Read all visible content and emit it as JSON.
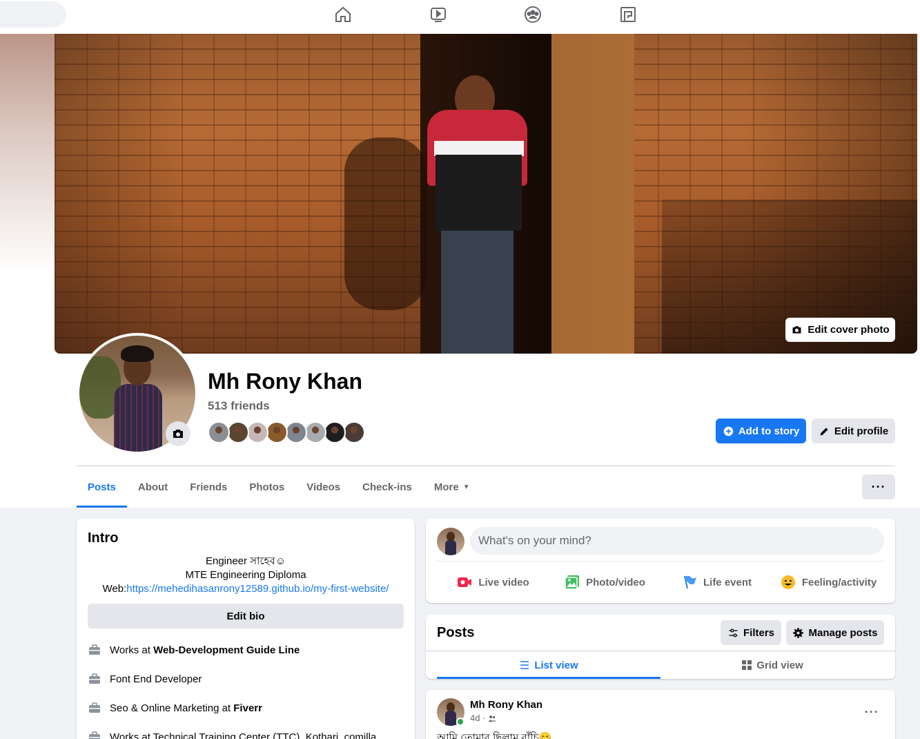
{
  "nav": {
    "icons": [
      "home-icon",
      "watch-icon",
      "groups-icon",
      "gaming-icon"
    ]
  },
  "cover": {
    "edit_label": "Edit cover photo"
  },
  "profile": {
    "name": "Mh Rony Khan",
    "friends_count": "513 friends",
    "friend_avatar_colors": [
      "#8b8f95",
      "#5a4630",
      "#c7b6b9",
      "#8a5a2a",
      "#7d8691",
      "#a9acae",
      "#1e1e1e",
      "#4a3b36"
    ]
  },
  "actions": {
    "add_story": "Add to story",
    "edit_profile": "Edit profile",
    "more_options": "···"
  },
  "tabs": [
    {
      "label": "Posts",
      "active": true
    },
    {
      "label": "About"
    },
    {
      "label": "Friends"
    },
    {
      "label": "Photos"
    },
    {
      "label": "Videos"
    },
    {
      "label": "Check-ins"
    },
    {
      "label": "More"
    }
  ],
  "intro": {
    "title": "Intro",
    "bio_line1": "Engineer সাহেব☺",
    "bio_line2": "MTE Engineering Diploma",
    "bio_web_prefix": "Web:",
    "bio_web_link": "https://mehedihasanrony12589.github.io/my-first-website/",
    "edit_bio": "Edit bio",
    "items": [
      {
        "prefix": "Works at ",
        "bold": "Web-Development Guide Line"
      },
      {
        "prefix": "Font End Developer",
        "bold": ""
      },
      {
        "prefix": "Seo & Online Marketing at ",
        "bold": "Fiverr"
      },
      {
        "prefix": "Works at Technical Training Center (TTC), Kothari, comilla",
        "bold": ""
      }
    ]
  },
  "composer": {
    "placeholder": "What's on your mind?",
    "live_video": "Live video",
    "photo_video": "Photo/video",
    "life_event": "Life event",
    "feeling": "Feeling/activity"
  },
  "posts_section": {
    "title": "Posts",
    "filters": "Filters",
    "manage_posts": "Manage posts",
    "list_view": "List view",
    "grid_view": "Grid view"
  },
  "post": {
    "author": "Mh Rony Khan",
    "time": "4d ·",
    "more": "···",
    "text": "আমি তোমার ছিলাম বাঁচি😊"
  },
  "colors": {
    "accent": "#1877f2",
    "button_gray": "#e4e6eb",
    "page_bg": "#f0f2f5"
  }
}
